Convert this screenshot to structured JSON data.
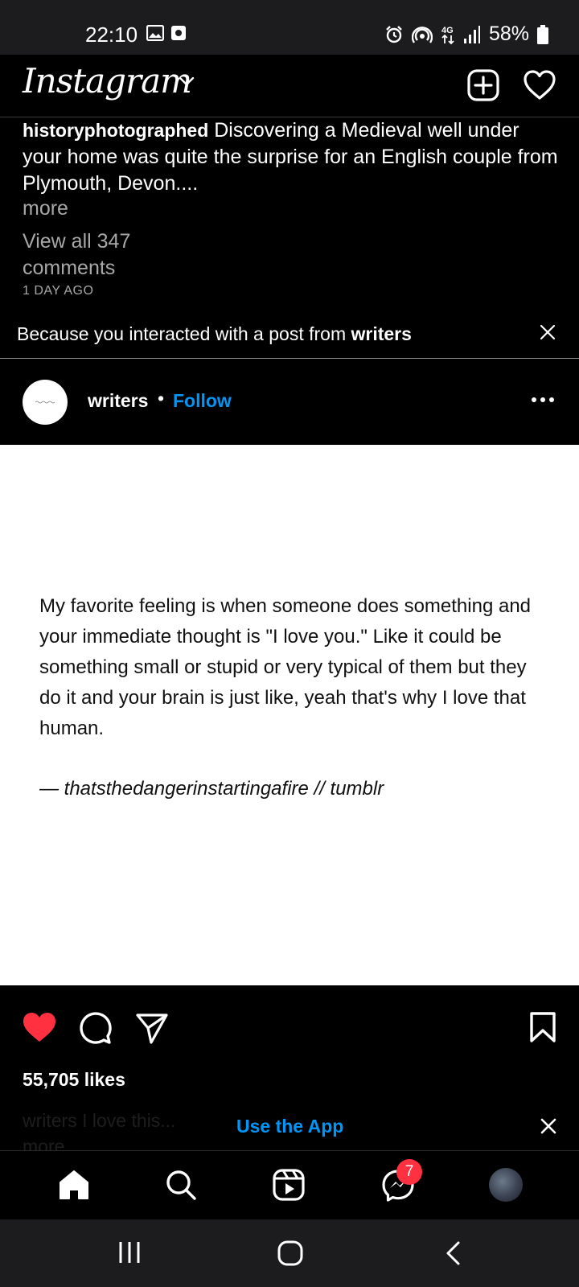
{
  "status_bar": {
    "time": "22:10",
    "left_icons": [
      "image-icon",
      "screen-record-icon"
    ],
    "right_icons": [
      "alarm-icon",
      "hotspot-icon",
      "4g-icon",
      "signal-icon",
      "battery-icon"
    ],
    "network": "4G",
    "battery": "58%"
  },
  "header": {
    "logo": "Instagram",
    "icons": [
      "chevron-down-icon",
      "new-post-icon",
      "heart-icon"
    ]
  },
  "previous_post": {
    "username": "historyphotographed",
    "caption": "Discovering a Medieval well under your home was quite the surprise for an English couple from Plymouth, Devon....",
    "more": "more",
    "view_comments": "View all 347 comments",
    "time": "1 DAY AGO"
  },
  "suggestion": {
    "text": "Because you interacted with a post from ",
    "source": "writers"
  },
  "post": {
    "username": "writers",
    "separator": "•",
    "follow": "Follow",
    "quote": "My favorite feeling is when someone does something and your immediate thought is \"I love you.\" Like it could be something small or stupid or very typical of them but they do it and your brain is just like, yeah that's why I love that human.",
    "quote_source": "— thatsthedangerinstartingafire // tumblr",
    "likes": "55,705 likes",
    "caption_preview": "writers I love this...",
    "caption_more": "more",
    "liked": true,
    "like_color": "#ff3040"
  },
  "use_app": {
    "label": "Use the App"
  },
  "bottom_nav": {
    "items": [
      "home-icon",
      "search-icon",
      "reels-icon",
      "messenger-icon",
      "profile-avatar"
    ],
    "messages_badge": "7"
  },
  "system_nav": {
    "items": [
      "recents-icon",
      "home-circle-icon",
      "back-icon"
    ]
  },
  "colors": {
    "accent": "#0095f6",
    "background": "#000000",
    "secondary_text": "#a8a8a8"
  }
}
